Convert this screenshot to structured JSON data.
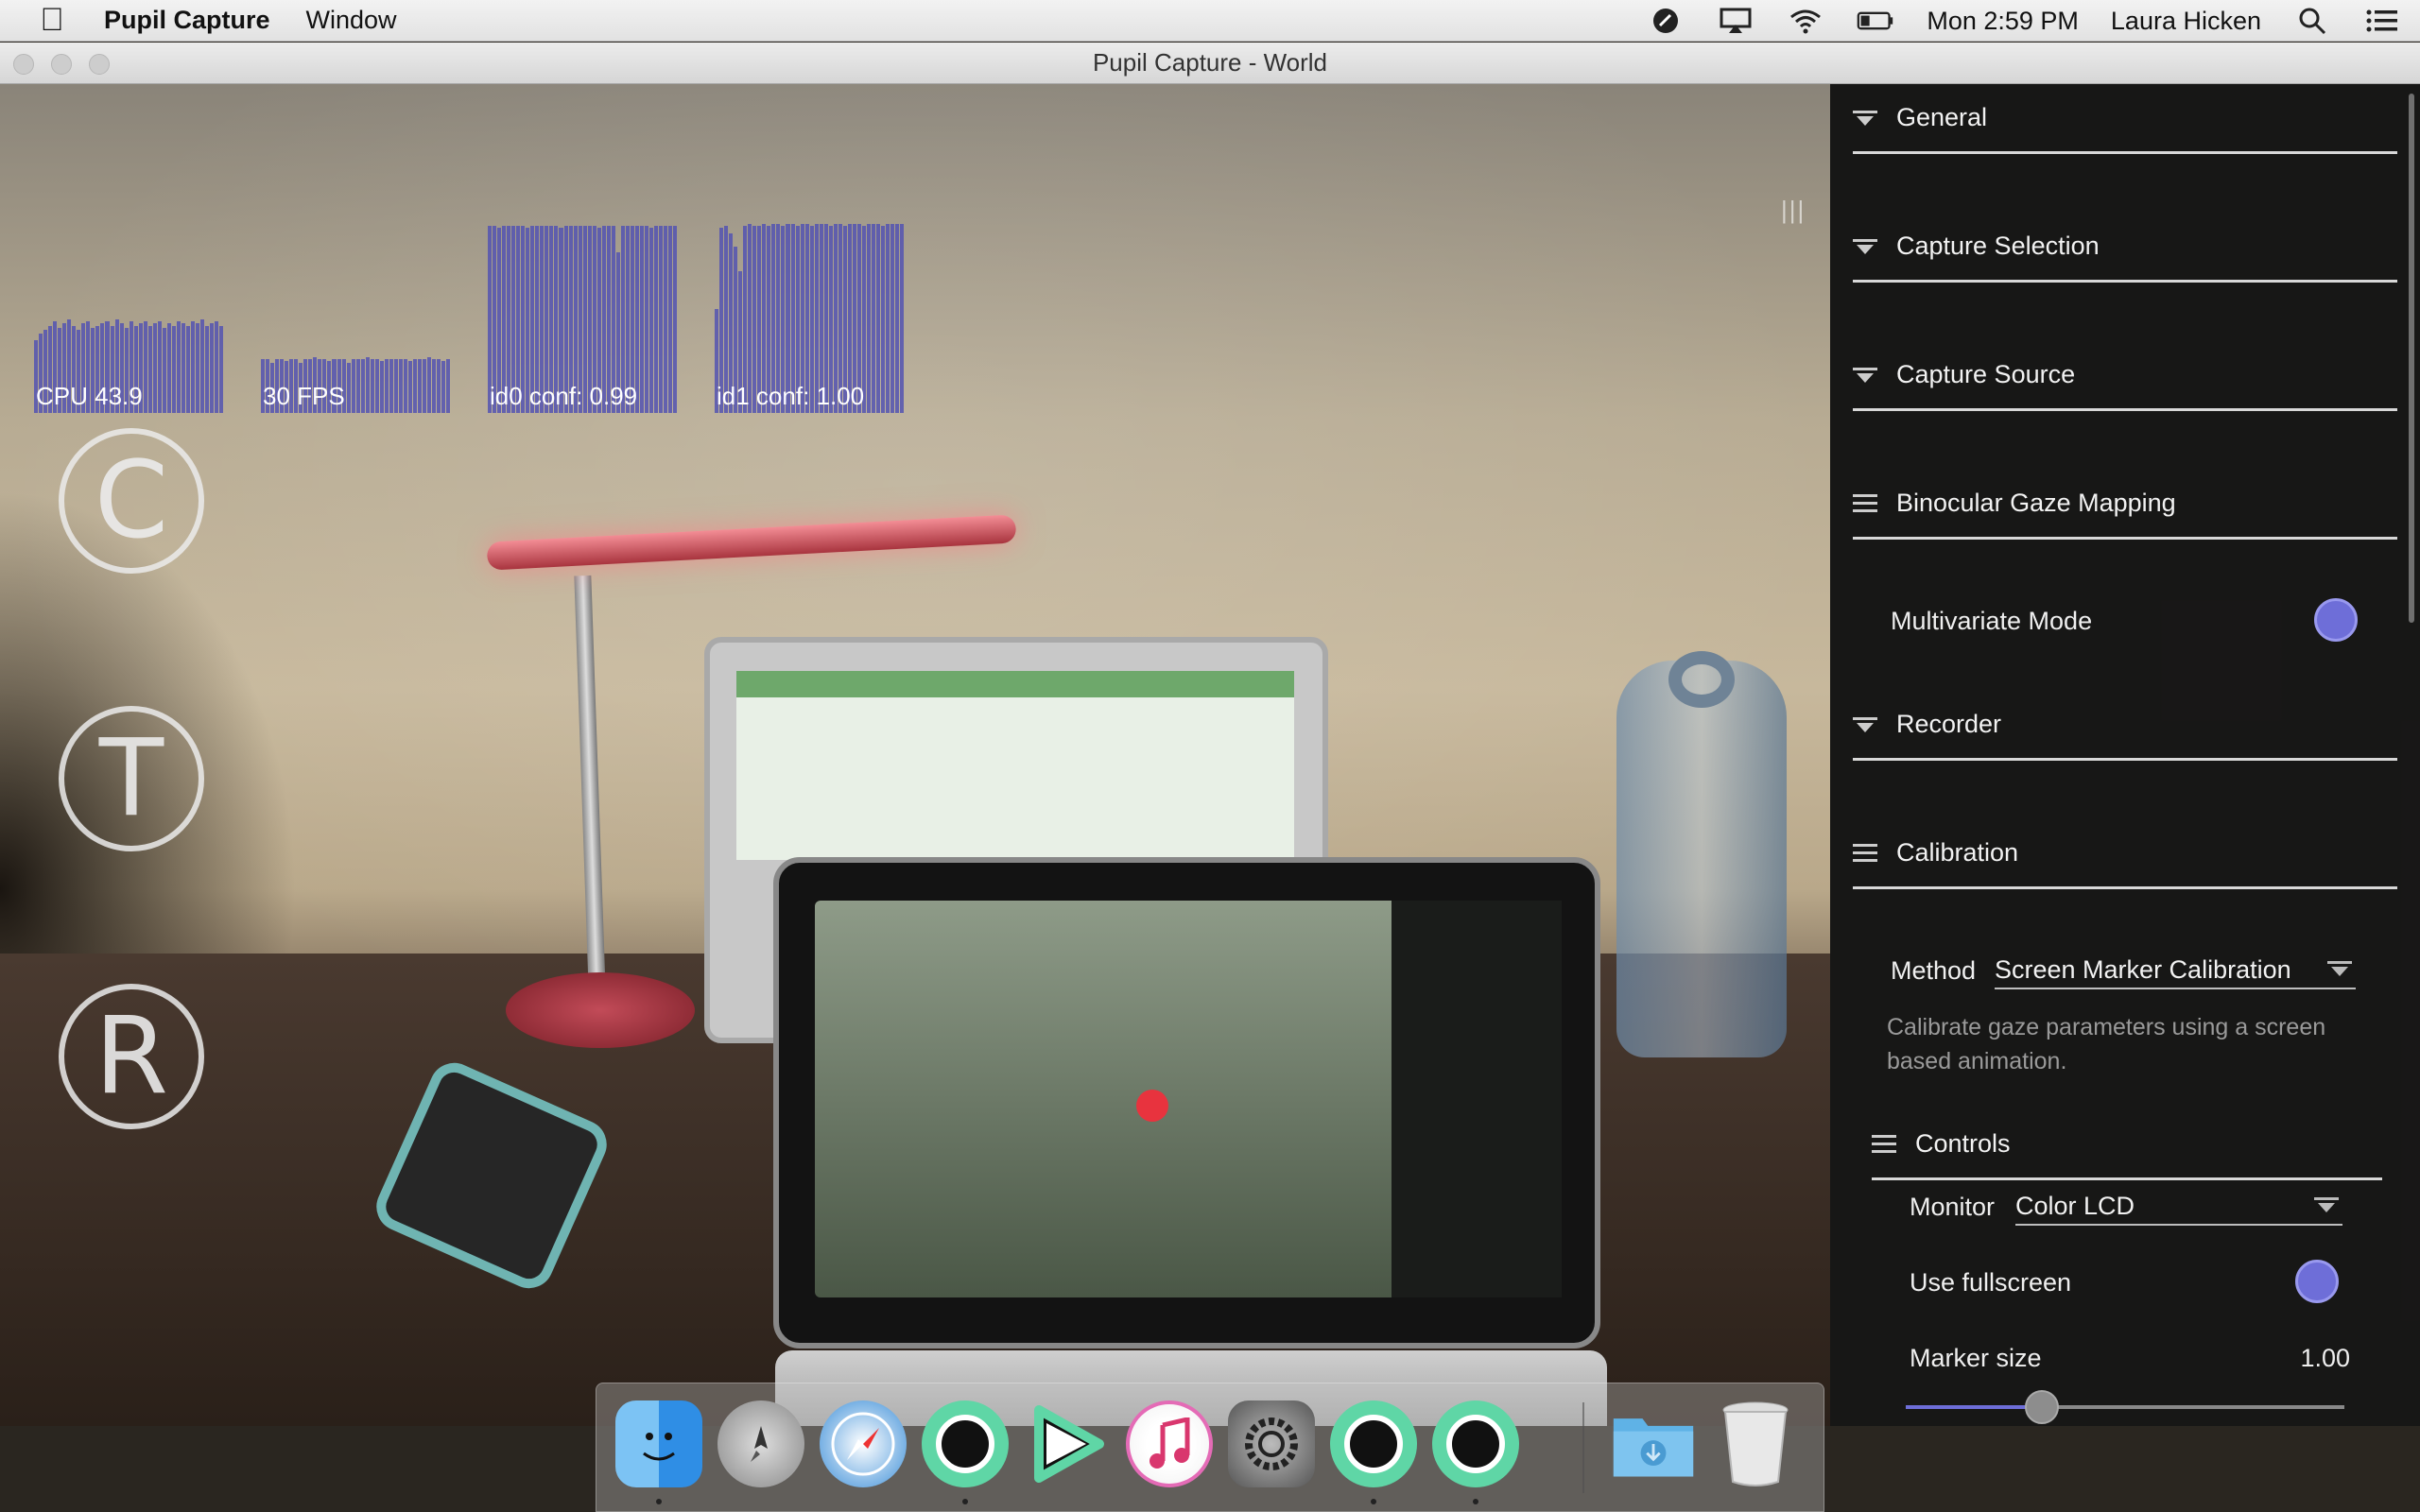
{
  "menubar": {
    "app_name": "Pupil Capture",
    "menus": [
      "Window"
    ],
    "clock": "Mon 2:59 PM",
    "user": "Laura Hicken"
  },
  "window": {
    "title": "Pupil Capture - World"
  },
  "graphs": [
    {
      "label": "CPU 43.9",
      "values": [
        0.35,
        0.38,
        0.4,
        0.42,
        0.44,
        0.41,
        0.43,
        0.45,
        0.42,
        0.4,
        0.43,
        0.44,
        0.41,
        0.42,
        0.43,
        0.44,
        0.42,
        0.45,
        0.43,
        0.41,
        0.44,
        0.42,
        0.43,
        0.44,
        0.42,
        0.43,
        0.44,
        0.41,
        0.43,
        0.42,
        0.44,
        0.43,
        0.42,
        0.44,
        0.43,
        0.45,
        0.42,
        0.43,
        0.44,
        0.42
      ]
    },
    {
      "label": "30 FPS",
      "values": [
        0.3,
        0.3,
        0.28,
        0.3,
        0.3,
        0.29,
        0.3,
        0.3,
        0.28,
        0.3,
        0.3,
        0.31,
        0.3,
        0.3,
        0.29,
        0.3,
        0.3,
        0.3,
        0.28,
        0.3,
        0.3,
        0.3,
        0.31,
        0.3,
        0.3,
        0.29,
        0.3,
        0.3,
        0.3,
        0.3,
        0.3,
        0.29,
        0.3,
        0.3,
        0.3,
        0.31,
        0.3,
        0.3,
        0.29,
        0.3
      ]
    },
    {
      "label": "id0 conf: 0.99",
      "values": [
        0.99,
        0.99,
        0.98,
        0.99,
        0.99,
        0.99,
        0.99,
        0.99,
        0.98,
        0.99,
        0.99,
        0.99,
        0.99,
        0.99,
        0.99,
        0.98,
        0.99,
        0.99,
        0.99,
        0.99,
        0.99,
        0.99,
        0.99,
        0.98,
        0.99,
        0.99,
        0.99,
        0.85,
        0.99,
        0.99,
        0.99,
        0.99,
        0.99,
        0.99,
        0.98,
        0.99,
        0.99,
        0.99,
        0.99,
        0.99
      ]
    },
    {
      "label": "id1 conf: 1.00",
      "values": [
        0.55,
        0.98,
        0.99,
        0.95,
        0.88,
        0.75,
        0.99,
        1.0,
        0.99,
        0.99,
        1.0,
        0.99,
        1.0,
        1.0,
        0.99,
        1.0,
        1.0,
        0.99,
        1.0,
        1.0,
        0.99,
        1.0,
        1.0,
        1.0,
        0.99,
        1.0,
        1.0,
        0.99,
        1.0,
        1.0,
        1.0,
        0.99,
        1.0,
        1.0,
        1.0,
        0.99,
        1.0,
        1.0,
        1.0,
        1.0
      ]
    }
  ],
  "side_buttons": [
    {
      "name": "calibrate-button",
      "glyph": "C"
    },
    {
      "name": "test-button",
      "glyph": "T"
    },
    {
      "name": "record-button",
      "glyph": "R"
    }
  ],
  "sidebar": {
    "general": "General",
    "capture_selection": "Capture Selection",
    "capture_source": "Capture Source",
    "binocular": "Binocular Gaze Mapping",
    "multivariate": "Multivariate Mode",
    "recorder": "Recorder",
    "calibration": "Calibration",
    "method_label": "Method",
    "method_value": "Screen Marker Calibration",
    "calibration_desc": "Calibrate gaze parameters using a screen based animation.",
    "controls": "Controls",
    "monitor_label": "Monitor",
    "monitor_value": "Color LCD",
    "fullscreen_label": "Use fullscreen",
    "marker_size_label": "Marker size",
    "marker_size_value": "1.00",
    "marker_size_fraction": 0.31
  },
  "colors": {
    "accent": "#6e6ed8",
    "graph_bar": "#5454b2"
  },
  "dock": {
    "items": [
      "finder-icon",
      "launchpad-icon",
      "safari-icon",
      "pupil-icon",
      "pupil-player-icon",
      "itunes-icon",
      "system-preferences-icon",
      "pupil-capture-icon",
      "pupil-service-icon",
      "downloads-icon",
      "trash-icon"
    ]
  }
}
